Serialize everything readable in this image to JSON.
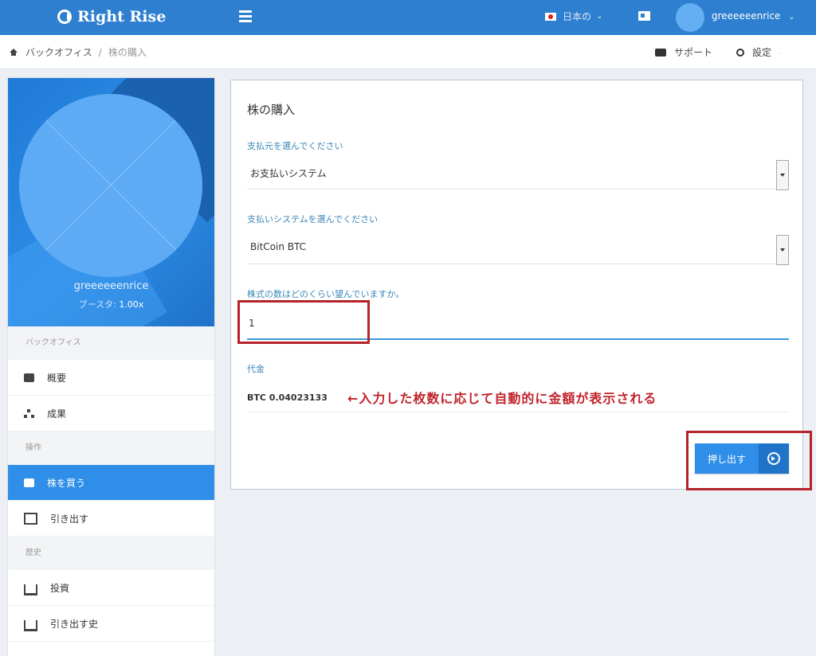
{
  "topbar": {
    "brand": "Right Rise",
    "language": "日本の",
    "username": "greeeeeenrice"
  },
  "breadcrumb": {
    "root": "バックオフィス",
    "separator": "/",
    "current": "株の購入"
  },
  "header_actions": {
    "support": "サポート",
    "settings": "設定"
  },
  "profile": {
    "name": "greeeeeenrice",
    "boost_label": "ブースタ:",
    "boost_value": "1.00x"
  },
  "sidebar": {
    "section_backoffice": "バックオフィス",
    "overview": "概要",
    "results": "成果",
    "section_operations": "操作",
    "buy_stock": "株を買う",
    "withdraw": "引き出す",
    "section_history": "歴史",
    "investment": "投資",
    "withdraw_history": "引き出す史"
  },
  "form": {
    "title": "株の購入",
    "payment_source_label": "支払元を選んでください",
    "payment_source_value": "お支払いシステム",
    "payment_system_label": "支払いシステムを選んでください",
    "payment_system_value": "BitCoin BTC",
    "quantity_label": "株式の数はどのくらい望んでいますか。",
    "quantity_value": "1",
    "price_label": "代金",
    "price_value": "BTC 0.04023133",
    "annotation": "←入力した枚数に応じて自動的に金額が表示される",
    "submit": "押し出す"
  },
  "colors": {
    "topbar": "#2e7fcf",
    "accent": "#2e8ee8",
    "annotation": "#c0232b"
  }
}
